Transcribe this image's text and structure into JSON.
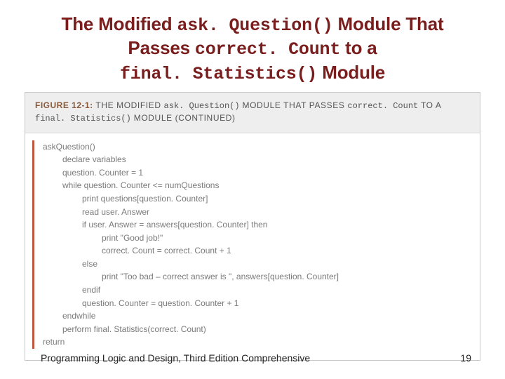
{
  "title": {
    "t1": "The Modified ",
    "m1": "ask. Question()",
    "t2": " Module That Passes ",
    "m2": "correct. Count",
    "t3": " to a ",
    "m3": "final. Statistics()",
    "t4": " Module"
  },
  "figure": {
    "label": "FIGURE 12-1:",
    "cap_t1": " THE MODIFIED ",
    "cap_m1": "ask. Question()",
    "cap_t2": " MODULE THAT PASSES ",
    "cap_m2": "correct. Count",
    "cap_t3": " TO A ",
    "cap_m3": "final. Statistics()",
    "cap_t4": " MODULE (CONTINUED)"
  },
  "code": [
    {
      "indent": 0,
      "text": "askQuestion()"
    },
    {
      "indent": 1,
      "text": "declare variables"
    },
    {
      "indent": 1,
      "text": "question. Counter = 1"
    },
    {
      "indent": 1,
      "text": "while question. Counter <= numQuestions"
    },
    {
      "indent": 2,
      "text": "print questions[question. Counter]"
    },
    {
      "indent": 2,
      "text": "read user. Answer"
    },
    {
      "indent": 2,
      "text": "if user. Answer = answers[question. Counter] then"
    },
    {
      "indent": 3,
      "text": "print \"Good job!\""
    },
    {
      "indent": 3,
      "text": "correct. Count = correct. Count + 1"
    },
    {
      "indent": 2,
      "text": "else"
    },
    {
      "indent": 3,
      "text": "print \"Too bad – correct answer is \", answers[question. Counter]"
    },
    {
      "indent": 2,
      "text": "endif"
    },
    {
      "indent": 2,
      "text": "question. Counter = question. Counter + 1"
    },
    {
      "indent": 1,
      "text": "endwhile"
    },
    {
      "indent": 1,
      "text": "perform final. Statistics(correct. Count)"
    },
    {
      "indent": 0,
      "text": "return"
    }
  ],
  "footer": {
    "book": "Programming Logic and Design, Third Edition Comprehensive",
    "page": "19"
  }
}
